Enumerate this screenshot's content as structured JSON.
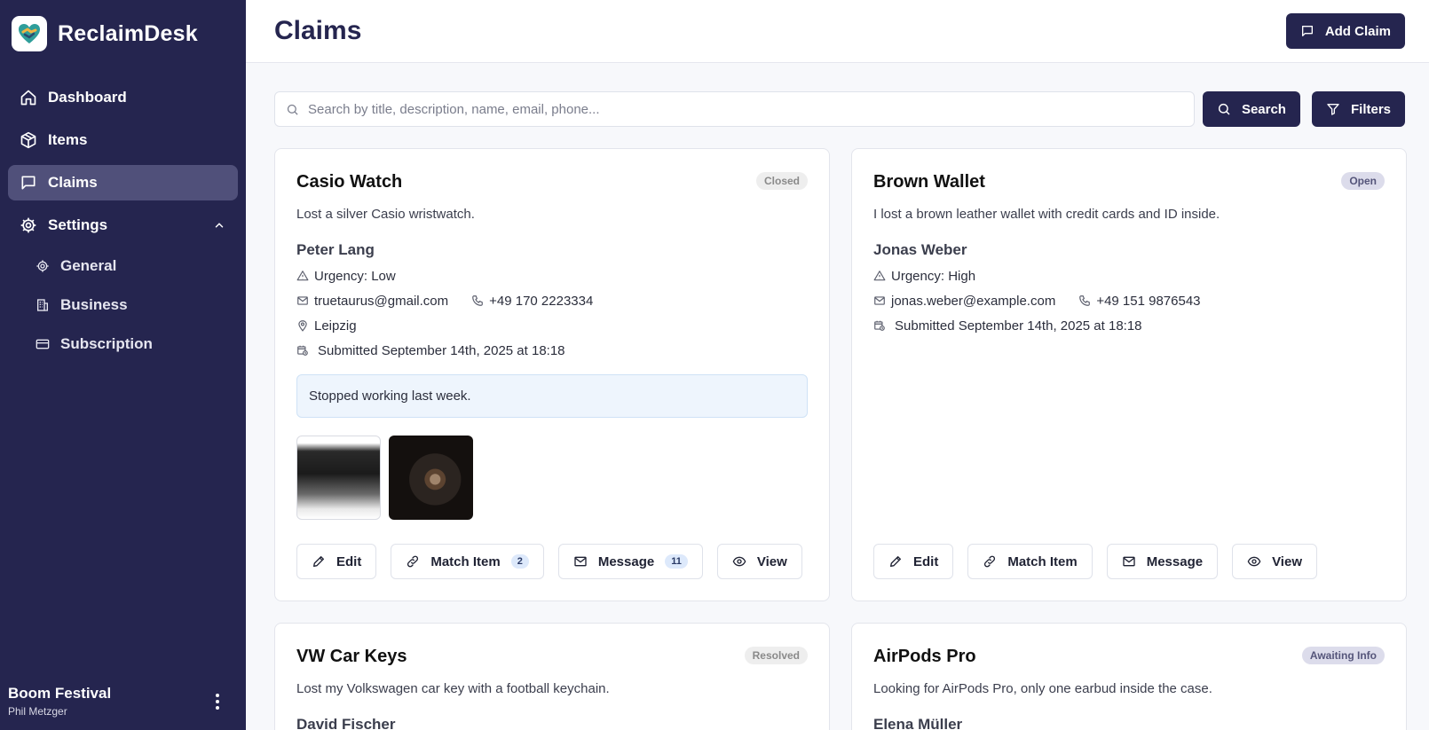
{
  "brand": {
    "name": "ReclaimDesk"
  },
  "nav": {
    "dashboard": "Dashboard",
    "items": "Items",
    "claims": "Claims",
    "settings": "Settings",
    "general": "General",
    "business": "Business",
    "subscription": "Subscription"
  },
  "org": {
    "name": "Boom Festival",
    "user": "Phil Metzger"
  },
  "header": {
    "title": "Claims",
    "add_label": "Add Claim"
  },
  "search": {
    "placeholder": "Search by title, description, name, email, phone...",
    "button": "Search",
    "filters": "Filters"
  },
  "cards": [
    {
      "title": "Casio Watch",
      "status": "Closed",
      "description": "Lost a silver Casio wristwatch.",
      "person": "Peter Lang",
      "urgency": "Urgency: Low",
      "email": "truetaurus@gmail.com",
      "phone": "+49 170 2223334",
      "location": "Leipzig",
      "submitted": "Submitted September 14th, 2025 at 18:18",
      "note": "Stopped working last week.",
      "actions": {
        "edit": "Edit",
        "match": "Match Item",
        "match_count": "2",
        "message": "Message",
        "message_count": "11",
        "view": "View"
      }
    },
    {
      "title": "Brown Wallet",
      "status": "Open",
      "description": "I lost a brown leather wallet with credit cards and ID inside.",
      "person": "Jonas Weber",
      "urgency": "Urgency: High",
      "email": "jonas.weber@example.com",
      "phone": "+49 151 9876543",
      "submitted": "Submitted September 14th, 2025 at 18:18",
      "actions": {
        "edit": "Edit",
        "match": "Match Item",
        "message": "Message",
        "view": "View"
      }
    },
    {
      "title": "VW Car Keys",
      "status": "Resolved",
      "description": "Lost my Volkswagen car key with a football keychain.",
      "person": "David Fischer"
    },
    {
      "title": "AirPods Pro",
      "status": "Awaiting Info",
      "description": "Looking for AirPods Pro, only one earbud inside the case.",
      "person": "Elena Müller"
    }
  ]
}
